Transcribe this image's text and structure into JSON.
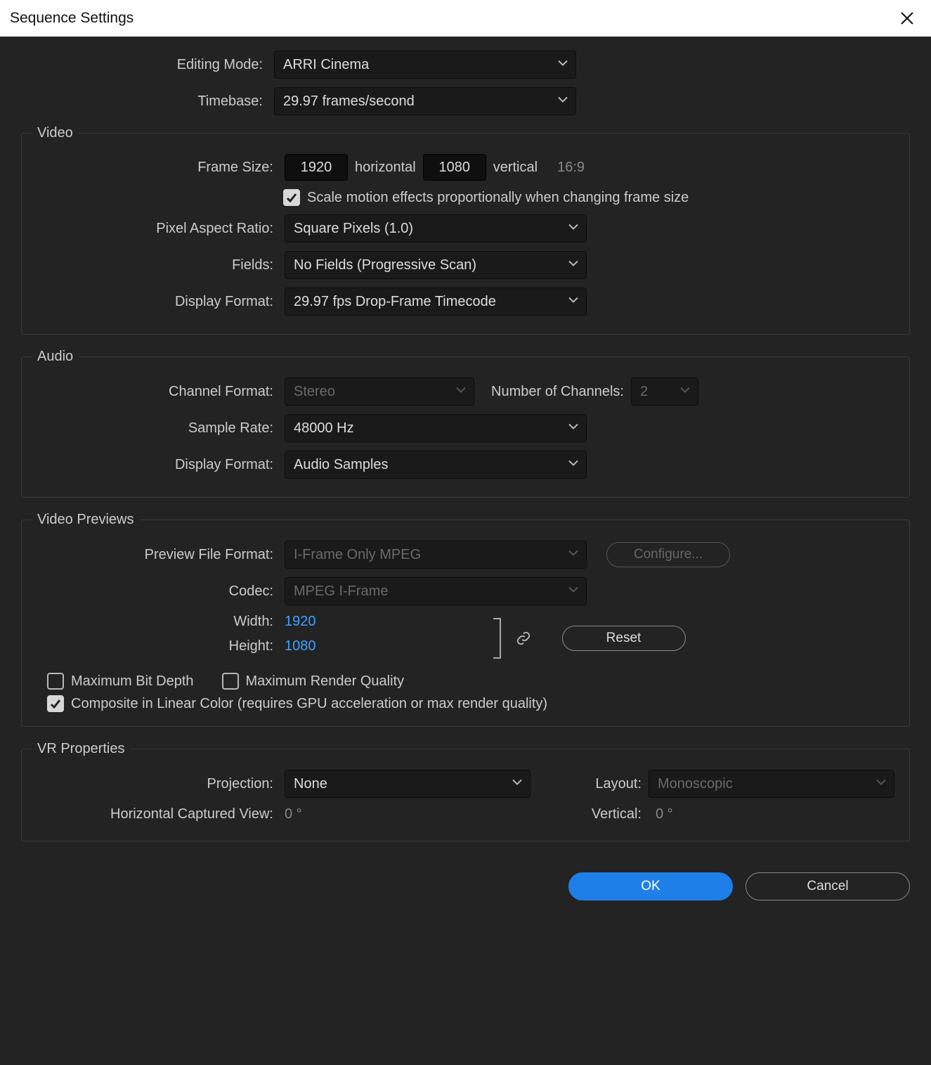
{
  "title": "Sequence Settings",
  "top": {
    "editingMode": {
      "label": "Editing Mode:",
      "value": "ARRI Cinema"
    },
    "timebase": {
      "label": "Timebase:",
      "value": "29.97  frames/second"
    }
  },
  "video": {
    "legend": "Video",
    "frameSize": {
      "label": "Frame Size:",
      "h": "1920",
      "hLabel": "horizontal",
      "v": "1080",
      "vLabel": "vertical",
      "ratio": "16:9"
    },
    "scaleMotion": {
      "checked": true,
      "label": "Scale motion effects proportionally when changing frame size"
    },
    "pixelAspect": {
      "label": "Pixel Aspect Ratio:",
      "value": "Square Pixels (1.0)"
    },
    "fields": {
      "label": "Fields:",
      "value": "No Fields (Progressive Scan)"
    },
    "displayFormat": {
      "label": "Display Format:",
      "value": "29.97 fps Drop-Frame Timecode"
    }
  },
  "audio": {
    "legend": "Audio",
    "channelFormat": {
      "label": "Channel Format:",
      "value": "Stereo"
    },
    "numChannels": {
      "label": "Number of Channels:",
      "value": "2"
    },
    "sampleRate": {
      "label": "Sample Rate:",
      "value": "48000 Hz"
    },
    "displayFormat": {
      "label": "Display Format:",
      "value": "Audio Samples"
    }
  },
  "previews": {
    "legend": "Video Previews",
    "previewFileFormat": {
      "label": "Preview File Format:",
      "value": "I-Frame Only MPEG"
    },
    "configure": "Configure...",
    "codec": {
      "label": "Codec:",
      "value": "MPEG I-Frame"
    },
    "width": {
      "label": "Width:",
      "value": "1920"
    },
    "height": {
      "label": "Height:",
      "value": "1080"
    },
    "reset": "Reset",
    "maxBitDepth": {
      "checked": false,
      "label": "Maximum Bit Depth"
    },
    "maxRenderQuality": {
      "checked": false,
      "label": "Maximum Render Quality"
    },
    "compositeLinear": {
      "checked": true,
      "label": "Composite in Linear Color (requires GPU acceleration or max render quality)"
    }
  },
  "vr": {
    "legend": "VR Properties",
    "projection": {
      "label": "Projection:",
      "value": "None"
    },
    "layout": {
      "label": "Layout:",
      "value": "Monoscopic"
    },
    "horizView": {
      "label": "Horizontal Captured View:",
      "value": "0 °"
    },
    "vertView": {
      "label": "Vertical:",
      "value": "0 °"
    }
  },
  "buttons": {
    "ok": "OK",
    "cancel": "Cancel"
  }
}
